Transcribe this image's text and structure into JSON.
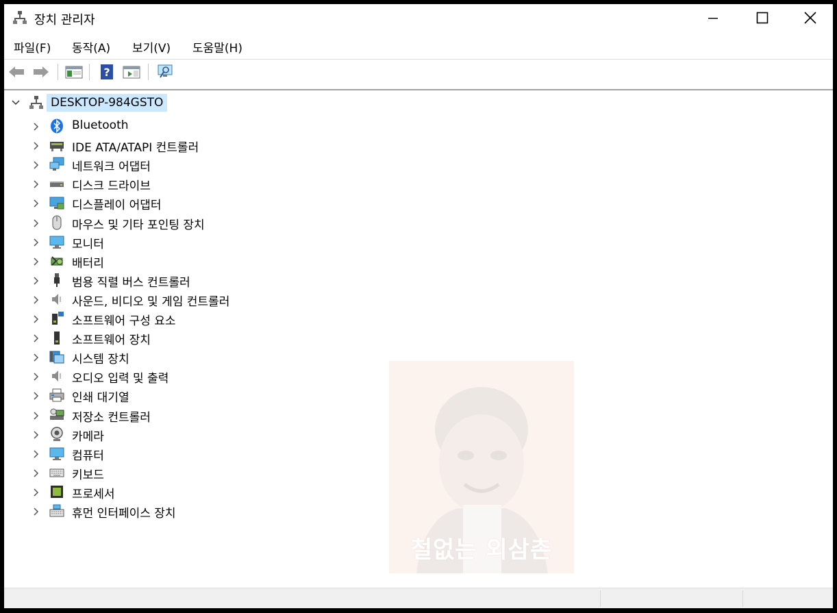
{
  "window": {
    "title": "장치 관리자"
  },
  "menu": [
    "파일(F)",
    "동작(A)",
    "보기(V)",
    "도움말(H)"
  ],
  "tree": {
    "root": "DESKTOP-984GSTO",
    "items": [
      {
        "label": "Bluetooth",
        "icon": "bluetooth-icon"
      },
      {
        "label": "IDE ATA/ATAPI 컨트롤러",
        "icon": "ide-controller-icon"
      },
      {
        "label": "네트워크 어댑터",
        "icon": "network-adapter-icon"
      },
      {
        "label": "디스크 드라이브",
        "icon": "disk-drive-icon"
      },
      {
        "label": "디스플레이 어댑터",
        "icon": "display-adapter-icon"
      },
      {
        "label": "마우스 및 기타 포인팅 장치",
        "icon": "mouse-icon"
      },
      {
        "label": "모니터",
        "icon": "monitor-icon"
      },
      {
        "label": "배터리",
        "icon": "battery-icon"
      },
      {
        "label": "범용 직렬 버스 컨트롤러",
        "icon": "usb-icon"
      },
      {
        "label": "사운드, 비디오 및 게임 컨트롤러",
        "icon": "speaker-icon"
      },
      {
        "label": "소프트웨어 구성 요소",
        "icon": "software-component-icon"
      },
      {
        "label": "소프트웨어 장치",
        "icon": "software-device-icon"
      },
      {
        "label": "시스템 장치",
        "icon": "system-device-icon"
      },
      {
        "label": "오디오 입력 및 출력",
        "icon": "audio-io-icon"
      },
      {
        "label": "인쇄 대기열",
        "icon": "printer-icon"
      },
      {
        "label": "저장소 컨트롤러",
        "icon": "storage-controller-icon"
      },
      {
        "label": "카메라",
        "icon": "camera-icon"
      },
      {
        "label": "컴퓨터",
        "icon": "computer-icon"
      },
      {
        "label": "키보드",
        "icon": "keyboard-icon"
      },
      {
        "label": "프로세서",
        "icon": "processor-icon"
      },
      {
        "label": "휴먼 인터페이스 장치",
        "icon": "hid-icon"
      }
    ]
  },
  "watermark": {
    "text": "철없는 외삼촌"
  },
  "colors": {
    "selection": "#cce8ff",
    "accent": "#0078d7"
  }
}
